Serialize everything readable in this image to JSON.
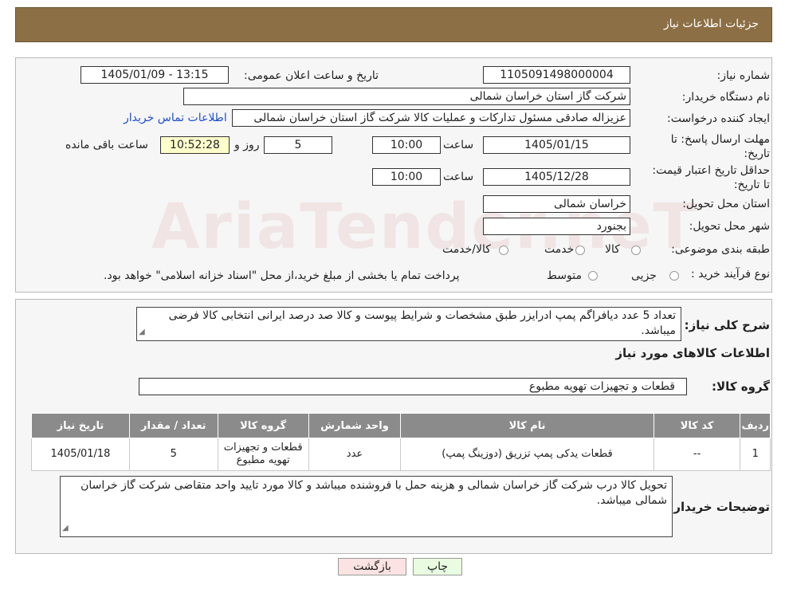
{
  "header": {
    "title": "جزئیات اطلاعات نیاز"
  },
  "watermark": "AriaTender.neT",
  "form": {
    "need_number_label": "شماره نیاز:",
    "need_number": "1105091498000004",
    "announce_label": "تاریخ و ساعت اعلان عمومی:",
    "announce_value": "1405/01/09 - 13:15",
    "buyer_label": "نام دستگاه خریدار:",
    "buyer_value": "شرکت گاز استان خراسان شمالی",
    "creator_label": "ایجاد کننده درخواست:",
    "creator_value": "عزیزاله صادقی مسئول تداركات و عملیات كالا شركت گاز استان خراسان شمالی",
    "contact_link": "اطلاعات تماس خریدار",
    "reply_deadline_label": "مهلت ارسال پاسخ: تا تاریخ:",
    "reply_date": "1405/01/15",
    "time_label": "ساعت",
    "reply_time": "10:00",
    "days_value": "5",
    "days_label": "روز و",
    "remaining_time": "10:52:28",
    "remaining_label": "ساعت باقی مانده",
    "price_validity_label": "حداقل تاریخ اعتبار قیمت: تا تاریخ:",
    "price_date": "1405/12/28",
    "price_time": "10:00",
    "province_label": "استان محل تحویل:",
    "province_value": "خراسان شمالی",
    "city_label": "شهر محل تحویل:",
    "city_value": "بجنورد",
    "category_label": "طبقه بندی موضوعی:",
    "category_options": [
      "کالا",
      "خدمت",
      "کالا/خدمت"
    ],
    "process_label": "نوع فرآیند خرید :",
    "process_options": [
      "جزیی",
      "متوسط"
    ],
    "process_note": "پرداخت تمام یا بخشی از مبلغ خرید،از محل \"اسناد خزانه اسلامی\" خواهد بود."
  },
  "description": {
    "label": "شرح کلی نیاز:",
    "text": "تعداد 5 عدد دیافراگم پمپ ادرایزر طبق مشخصات و شرایط پیوست و کالا صد درصد ایرانی انتخابی کالا فرضی میباشد.",
    "goods_info_title": "اطلاعات کالاهای مورد نیاز",
    "goods_group_label": "گروه کالا:",
    "goods_group_value": "قطعات و تجهیزات تهویه مطبوع"
  },
  "table": {
    "headers": [
      "ردیف",
      "کد کالا",
      "نام کالا",
      "واحد شمارش",
      "گروه کالا",
      "تعداد / مقدار",
      "تاریخ نیاز"
    ],
    "rows": [
      [
        "1",
        "--",
        "قطعات یدکی پمپ تزریق (دوزینگ پمپ)",
        "عدد",
        "قطعات و تجهیزات تهویه مطبوع",
        "5",
        "1405/01/18"
      ]
    ]
  },
  "buyer_notes": {
    "label": "توضیحات خریدار:",
    "text": "تحویل کالا درب شرکت گاز خراسان شمالی و هزینه حمل با فروشنده میباشد و کالا مورد تایید واحد متقاضی شرکت گاز خراسان شمالی میباشد."
  },
  "buttons": {
    "print": "چاپ",
    "back": "بازگشت"
  },
  "colors": {
    "header_bg": "#8c6f45",
    "table_header_bg": "#8b8b8b",
    "link": "#1f4fd0",
    "print_btn": "#e9fbe1",
    "back_btn": "#fbe3e3"
  }
}
